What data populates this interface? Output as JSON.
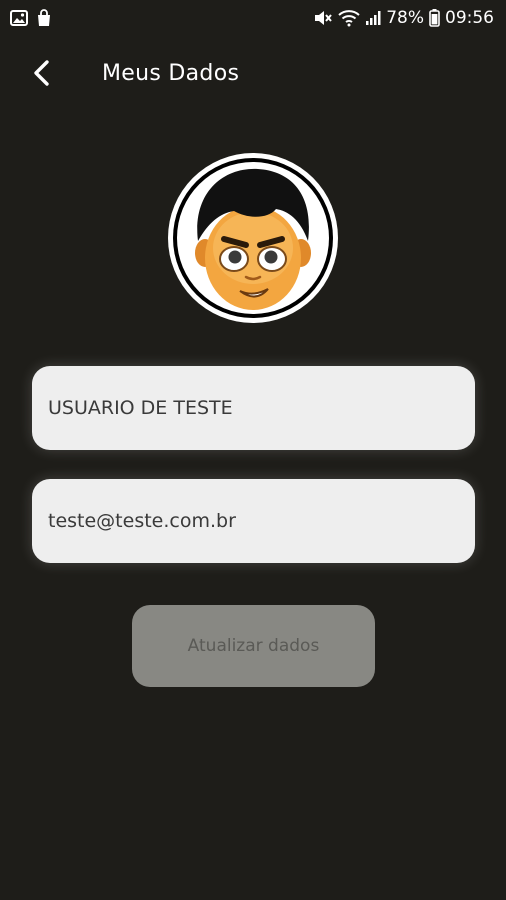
{
  "status_bar": {
    "battery": "78%",
    "time": "09:56",
    "icons_left": [
      "image-icon",
      "shopping-bag-icon"
    ],
    "icons_right": [
      "mute-icon",
      "wifi-icon",
      "signal-icon",
      "battery-icon"
    ]
  },
  "header": {
    "title": "Meus Dados",
    "back_icon": "chevron-left-icon"
  },
  "profile": {
    "avatar_icon": "cartoon-face-avatar"
  },
  "form": {
    "name_value": "USUARIO DE TESTE",
    "email_value": "teste@teste.com.br",
    "submit_label": "Atualizar dados"
  },
  "colors": {
    "background": "#1e1d19",
    "field_bg": "#eeeeee",
    "button_bg": "#888883",
    "button_text": "#5a5a56"
  }
}
